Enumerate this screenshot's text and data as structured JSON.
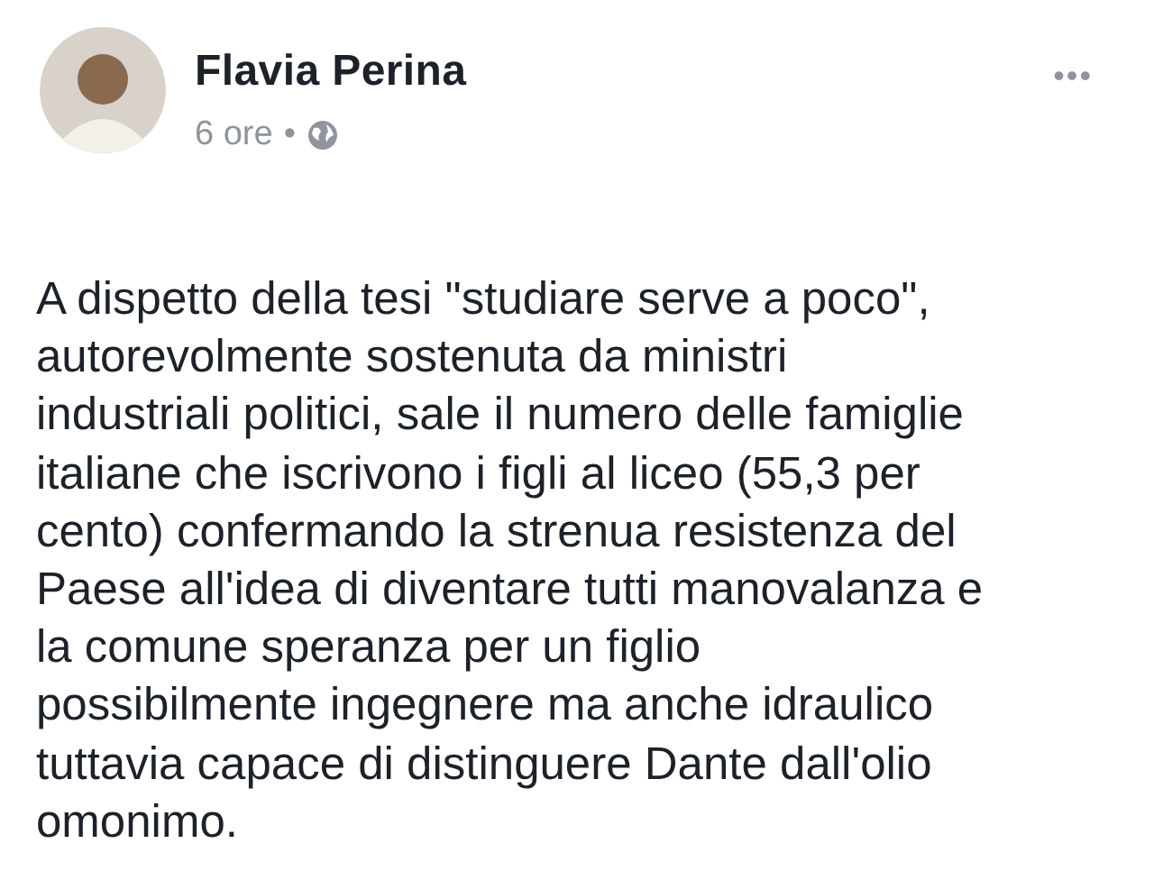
{
  "post": {
    "author": "Flavia Perina",
    "time": "6 ore",
    "separator": "•",
    "menu": "•••",
    "text": "A dispetto della tesi \"studiare serve a poco\",\nautorevolmente sostenuta da ministri\nindustriali politici, sale il numero delle famiglie\nitaliane che iscrivono i figli al liceo (55,3 per\ncento) confermando la strenua resistenza del\nPaese all'idea di diventare tutti manovalanza e\nla comune speranza per un figlio\npossibilmente ingegnere ma anche idraulico\ntuttavia capace di distinguere Dante dall'olio\nomonimo."
  }
}
